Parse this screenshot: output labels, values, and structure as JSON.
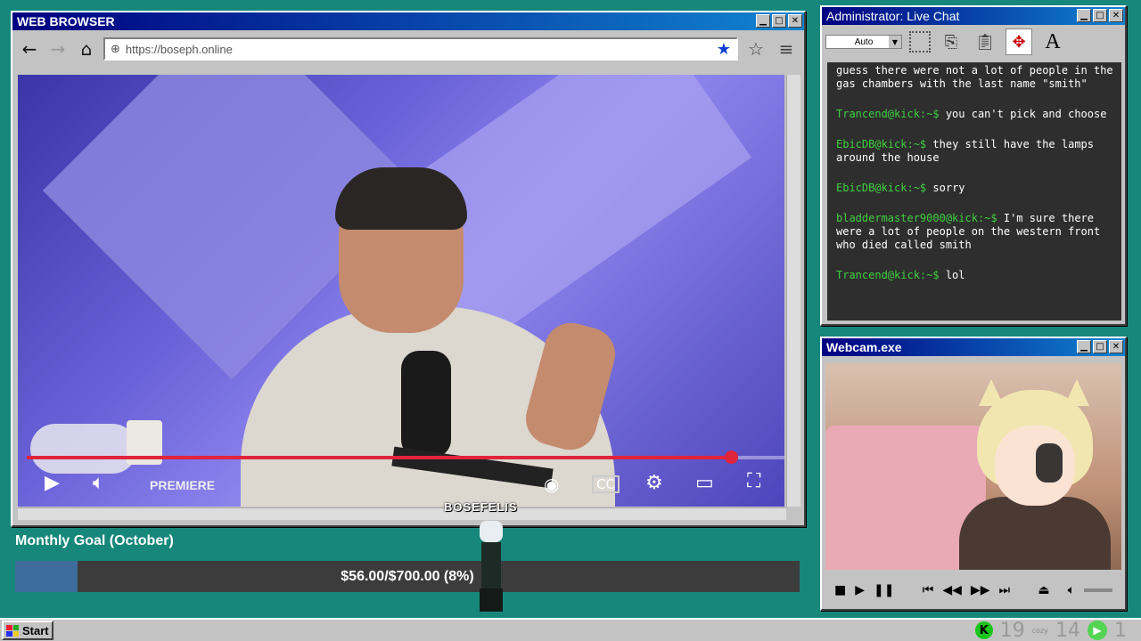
{
  "browser": {
    "title": "WEB BROWSER",
    "url": "https://boseph.online",
    "video": {
      "premiere_label": "PREMIERE",
      "progress": 0.93
    }
  },
  "chat": {
    "title": "Administrator: Live Chat",
    "font_select": "Auto",
    "messages": [
      {
        "user": "",
        "text": "guess there were not a lot of people in the gas chambers with the last name \"smith\""
      },
      {
        "user": "Trancend@kick:~$",
        "text": "you can't pick and choose"
      },
      {
        "user": "EbicDB@kick:~$",
        "text": "they still have the lamps around the house"
      },
      {
        "user": "EbicDB@kick:~$",
        "text": "sorry"
      },
      {
        "user": "bladdermaster9000@kick:~$",
        "text": "I'm sure there were a lot of people on the western front who died called smith"
      },
      {
        "user": "Trancend@kick:~$",
        "text": "lol"
      }
    ],
    "user_color": "#3ed13e"
  },
  "webcam": {
    "title": "Webcam.exe"
  },
  "goal": {
    "title": "Monthly Goal (October)",
    "text": "$56.00/$700.00 (8%)",
    "fraction": 0.08
  },
  "sprite": {
    "name": "BOSEFELIS"
  },
  "taskbar": {
    "start_label": "Start",
    "kick_label": "K",
    "count1": "19",
    "cozy_label": "cozy",
    "count2": "14",
    "count3": "1"
  }
}
